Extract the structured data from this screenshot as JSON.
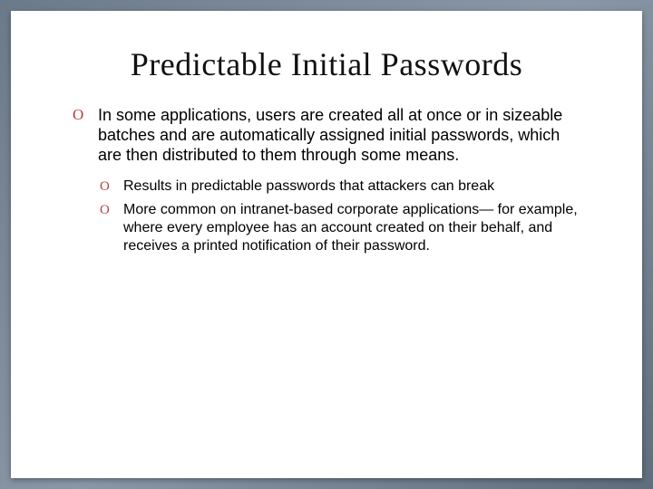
{
  "slide": {
    "title": "Predictable Initial Passwords",
    "marker": "O",
    "main_point": "In some applications, users are created all at once or in sizeable batches and are automatically assigned initial passwords, which are then distributed to them through some means.",
    "sub_points": [
      "Results in predictable passwords that attackers can break",
      "More common on intranet-based corporate applications— for example, where every employee has an account created on their behalf, and receives a printed notification of their password."
    ]
  }
}
